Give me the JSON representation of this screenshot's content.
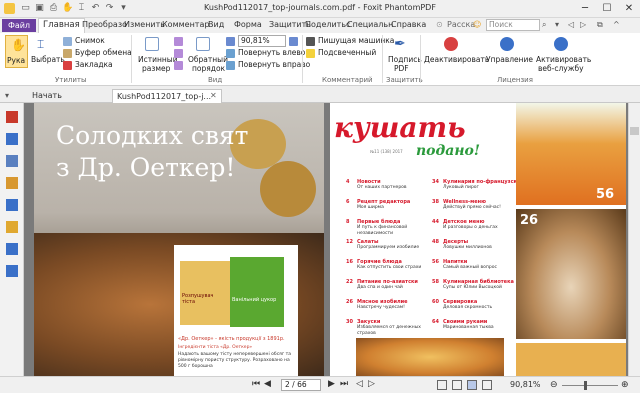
{
  "window": {
    "title": "KushPod112017_top-journals.com.pdf - Foxit PhantomPDF",
    "minimize": "─",
    "maximize": "☐",
    "close": "✕"
  },
  "menu": {
    "file": "Файл",
    "tabs": [
      "Главная",
      "Преобразо",
      "Изменить",
      "Комментар",
      "Вид",
      "Форма",
      "Защитить",
      "Поделитьс",
      "Специальн",
      "Справка"
    ],
    "user": "Расска",
    "search_placeholder": "Поиск"
  },
  "ribbon": {
    "hand": "Рука",
    "select": "Выбрать",
    "snapshot": "Снимок",
    "clipboard": "Буфер обмена",
    "bookmark": "Закладка",
    "actual_size": [
      "Истинный",
      "размер"
    ],
    "reflow": [
      "Обратный",
      "порядок"
    ],
    "zoom": "90,81%",
    "rotate_left": "Повернуть влево",
    "rotate_right": "Повернуть вправо",
    "typewriter": "Пишущая машинка",
    "highlight": "Подсвеченный",
    "sign": [
      "Подпись",
      "PDF"
    ],
    "deactivate": "Деактивировать",
    "manage": "Управление",
    "activate": [
      "Активировать",
      "веб-службу"
    ],
    "groups": {
      "utilities": "Утилиты",
      "view": "Вид",
      "comment": "Комментарий",
      "protect": "Защитить",
      "license": "Лицензия"
    }
  },
  "tabs": {
    "start": "Начать",
    "doc": "KushPod112017_top-j..."
  },
  "left_page": {
    "heading_line1": "Солодких свят",
    "heading_line2": "з Др. Оеткер!",
    "caption": "«Др. Оеткер» - якість продукції з 1891р.",
    "caption_sub": "Інгредієнти тіста «Др. Оеткер»",
    "caption_body": "Надають вашому тісту неперевершені обсяг та рівномірну пористу структуру. Розраховано на 500 г борошна",
    "pack1": "Розпушувач тіста",
    "pack2": "Ванільний цукор"
  },
  "right_page": {
    "logo_word1": "кушать",
    "logo_word2": "подано!",
    "issue_label": "№11 (138) 2017",
    "photo_numbers": [
      "56",
      "26"
    ],
    "toc_left": [
      {
        "num": "4",
        "title": "Новости",
        "sub": "От наших партнеров"
      },
      {
        "num": "6",
        "title": "Рецепт редактора",
        "sub": "Моя ширма"
      },
      {
        "num": "8",
        "title": "Первые блюда",
        "sub": "И путь к финансовой независимости"
      },
      {
        "num": "12",
        "title": "Салаты",
        "sub": "Программируем изобилие"
      },
      {
        "num": "16",
        "title": "Горячие блюда",
        "sub": "Как отпустить свои страхи"
      },
      {
        "num": "22",
        "title": "Питание по-азиатски",
        "sub": "Два спа и один чай"
      },
      {
        "num": "26",
        "title": "Мясное изобилие",
        "sub": "Навстречу чудесам!"
      },
      {
        "num": "30",
        "title": "Закуски",
        "sub": "Избавляемся от денежных страхов"
      }
    ],
    "toc_right": [
      {
        "num": "34",
        "title": "Кулинария по-французски",
        "sub": "Луковый пирог"
      },
      {
        "num": "38",
        "title": "Wellness-меню",
        "sub": "Действуй прямо сейчас!"
      },
      {
        "num": "44",
        "title": "Детское меню",
        "sub": "И разговоры о деньгах"
      },
      {
        "num": "48",
        "title": "Десерты",
        "sub": "Ловушки миллионов"
      },
      {
        "num": "56",
        "title": "Напитки",
        "sub": "Самый важный вопрос"
      },
      {
        "num": "58",
        "title": "Кулинарная библиотека",
        "sub": "Супы от Юлии Высоцкой"
      },
      {
        "num": "60",
        "title": "Сервировка",
        "sub": "Деловая скромность"
      },
      {
        "num": "64",
        "title": "Своими руками",
        "sub": "Маринованная тыква"
      }
    ]
  },
  "status": {
    "page": "2 / 66",
    "zoom": "90,81%"
  },
  "colors": {
    "purple": "#6b3fa0",
    "red": "#d6192b",
    "green": "#2b9a3c"
  }
}
